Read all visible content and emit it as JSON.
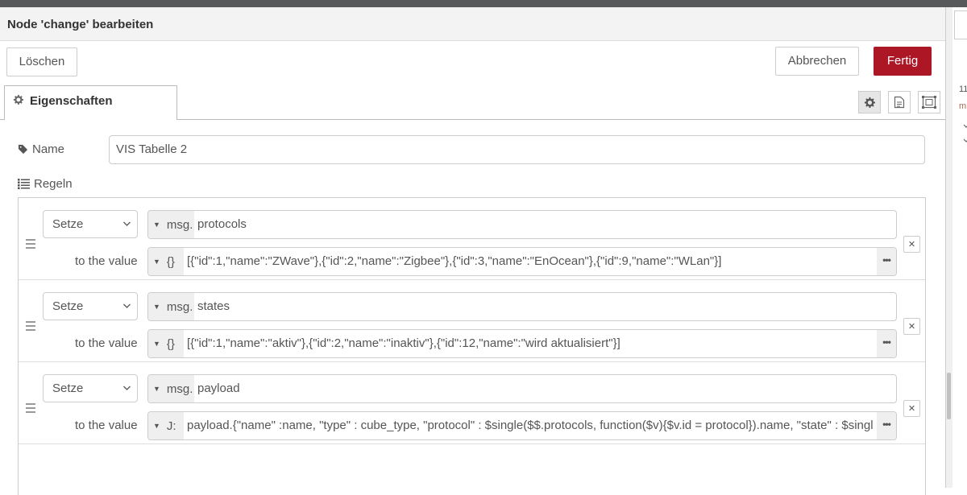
{
  "dialog": {
    "title": "Node 'change' bearbeiten",
    "delete_label": "Löschen",
    "cancel_label": "Abbrechen",
    "done_label": "Fertig"
  },
  "tabs": {
    "properties_label": "Eigenschaften"
  },
  "form": {
    "name_label": "Name",
    "name_value": "VIS Tabelle 2",
    "rules_label": "Regeln"
  },
  "rules": [
    {
      "action": "Setze",
      "target_prefix": "msg.",
      "target_value": "protocols",
      "to_label": "to the value",
      "value_type": "{}",
      "value": "[{\"id\":1,\"name\":\"ZWave\"},{\"id\":2,\"name\":\"Zigbee\"},{\"id\":3,\"name\":\"EnOcean\"},{\"id\":9,\"name\":\"WLan\"}]"
    },
    {
      "action": "Setze",
      "target_prefix": "msg.",
      "target_value": "states",
      "to_label": "to the value",
      "value_type": "{}",
      "value": "[{\"id\":1,\"name\":\"aktiv\"},{\"id\":2,\"name\":\"inaktiv\"},{\"id\":12,\"name\":\"wird aktualisiert\"}]"
    },
    {
      "action": "Setze",
      "target_prefix": "msg.",
      "target_value": "payload",
      "to_label": "to the value",
      "value_type": "J:",
      "value": "payload.{\"name\" :name,  \"type\" : cube_type,  \"protocol\" : $single($$.protocols, function($v){$v.id = protocol}).name,  \"state\" : $single($$.states, function($v){$v.id = state}).name}"
    }
  ],
  "side": {
    "text_1": "11",
    "text_2": "m"
  },
  "icons": {
    "gear": "gear-icon",
    "tag": "tag-icon",
    "list": "list-icon",
    "description": "description-icon",
    "appearance": "appearance-icon",
    "drag": "drag-handle-icon",
    "remove": "remove-icon",
    "expand": "expand-icon"
  },
  "colors": {
    "primary": "#ad1625",
    "border": "#cccccc",
    "type_bg": "#efefef",
    "topbar": "#58595b"
  }
}
